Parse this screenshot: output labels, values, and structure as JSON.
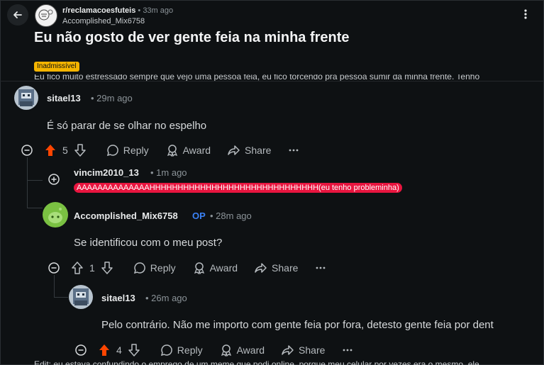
{
  "post": {
    "subreddit": "r/reclamacoesfuteis",
    "time": "• 33m ago",
    "author": "Accomplished_Mix6758",
    "title": "Eu não gosto de ver gente feia na minha frente",
    "flair": "Inadmissível",
    "body_cut": "Eu fico muito estressado sempre que vejo uma pessoa feia, eu fico torcendo pra pessoa sumir da minha frente. Tenho"
  },
  "comments": [
    {
      "user": "sitael13",
      "time": "• 29m ago",
      "text": "É só parar de se olhar no espelho",
      "score": "5",
      "reply": "Reply",
      "award": "Award",
      "share": "Share"
    },
    {
      "user": "vincim2010_13",
      "time": "• 1m ago",
      "text": "AAAAAAAAAAAAAAHHHHHHHHHHHHHHHHHHHHHHHHHHHHHH(eu tenho probleminha)"
    },
    {
      "user": "Accomplished_Mix6758",
      "op": "OP",
      "time": "• 28m ago",
      "text": "Se identificou com o meu post?",
      "score": "1",
      "reply": "Reply",
      "award": "Award",
      "share": "Share"
    },
    {
      "user": "sitael13",
      "time": "• 26m ago",
      "text": "Pelo contrário. Não me importo com gente feia por fora, detesto gente feia por dent",
      "score": "4",
      "reply": "Reply",
      "award": "Award",
      "share": "Share"
    }
  ],
  "footer_cut": "Edit: eu estava confundindo o emprego de um meme que podi online, porque meu celular por vezes era o mesmo, ele",
  "colors": {
    "background": "#0e1113",
    "upvote_active": "#ff4500",
    "flair": "#f4b400",
    "highlight": "#e8153f",
    "op": "#3b82f6"
  }
}
